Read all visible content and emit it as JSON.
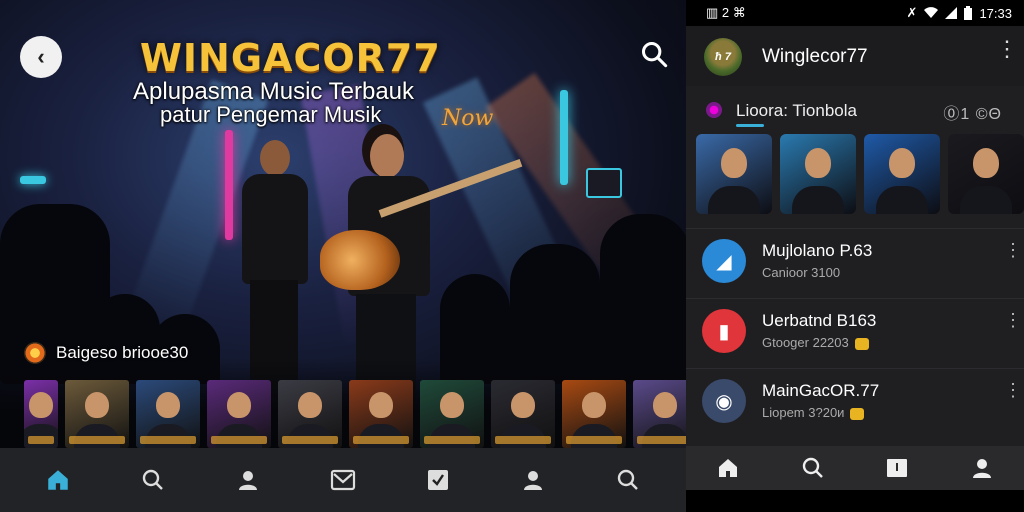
{
  "hero": {
    "title": "WINGACOR77",
    "subtitle_line1": "Aplupasma Music Terbauk",
    "subtitle_line2": "patur Pengemar Musik",
    "neon_sign": "Now",
    "section_label": "Baigeso briooe30",
    "thumbnails": [
      {
        "icon": "thumb-purple",
        "bg": "#7b2fa8"
      },
      {
        "icon": "thumb-person",
        "bg": "#6c5a3a"
      },
      {
        "icon": "thumb-helmet",
        "bg": "#2b4a7a"
      },
      {
        "icon": "thumb-woman",
        "bg": "#5a2a7a"
      },
      {
        "icon": "thumb-street",
        "bg": "#3b3b44"
      },
      {
        "icon": "thumb-poster",
        "bg": "#8a3a1a"
      },
      {
        "icon": "thumb-band",
        "bg": "#1f4a3a"
      },
      {
        "icon": "thumb-guitar",
        "bg": "#2a2a32"
      },
      {
        "icon": "thumb-warrior",
        "bg": "#a84a12"
      },
      {
        "icon": "thumb-speaker",
        "bg": "#5a4a8a"
      }
    ]
  },
  "left_nav": [
    "home-icon",
    "search-icon",
    "profile-icon",
    "inbox-icon",
    "edit-icon",
    "location-icon",
    "search-icon"
  ],
  "phone": {
    "status_left": "▥ 2 ⌘",
    "status_time": "17:33",
    "app_avatar_text": "ħ 7",
    "app_title": "Winglecor77",
    "tab_label": "Lioora: Tionbola",
    "tab_right": "⓪1 ©Θ",
    "cards": [
      {
        "icon": "card-player",
        "bg": "#3a6aa8"
      },
      {
        "icon": "card-album",
        "bg": "#2a7ab0"
      },
      {
        "icon": "card-artist",
        "bg": "#1f5aa8"
      },
      {
        "icon": "card-speaker",
        "bg": "#1a1a1f"
      },
      {
        "icon": "card-partial",
        "bg": "#555"
      }
    ],
    "list": [
      {
        "title": "Mujlolano P.63",
        "sub": "Canioor 3100",
        "icon_bg": "#2b8ad8",
        "icon": "chat-icon",
        "badge": false
      },
      {
        "title": "Uerbatnd B163",
        "sub": "Gtooger 22203",
        "icon_bg": "#e0353a",
        "icon": "book-icon",
        "badge": true
      },
      {
        "title": "MainGacOR.77",
        "sub": "Liopem 3?20и",
        "icon_bg": "#3a4a6a",
        "icon": "speaker-icon",
        "badge": true
      }
    ]
  },
  "right_nav": [
    "home-icon",
    "search-icon",
    "library-icon",
    "profile-icon"
  ],
  "colors": {
    "accent": "#3ab0d8",
    "title_gold": "#f6c23a",
    "panel_bg": "#1f1f22"
  }
}
